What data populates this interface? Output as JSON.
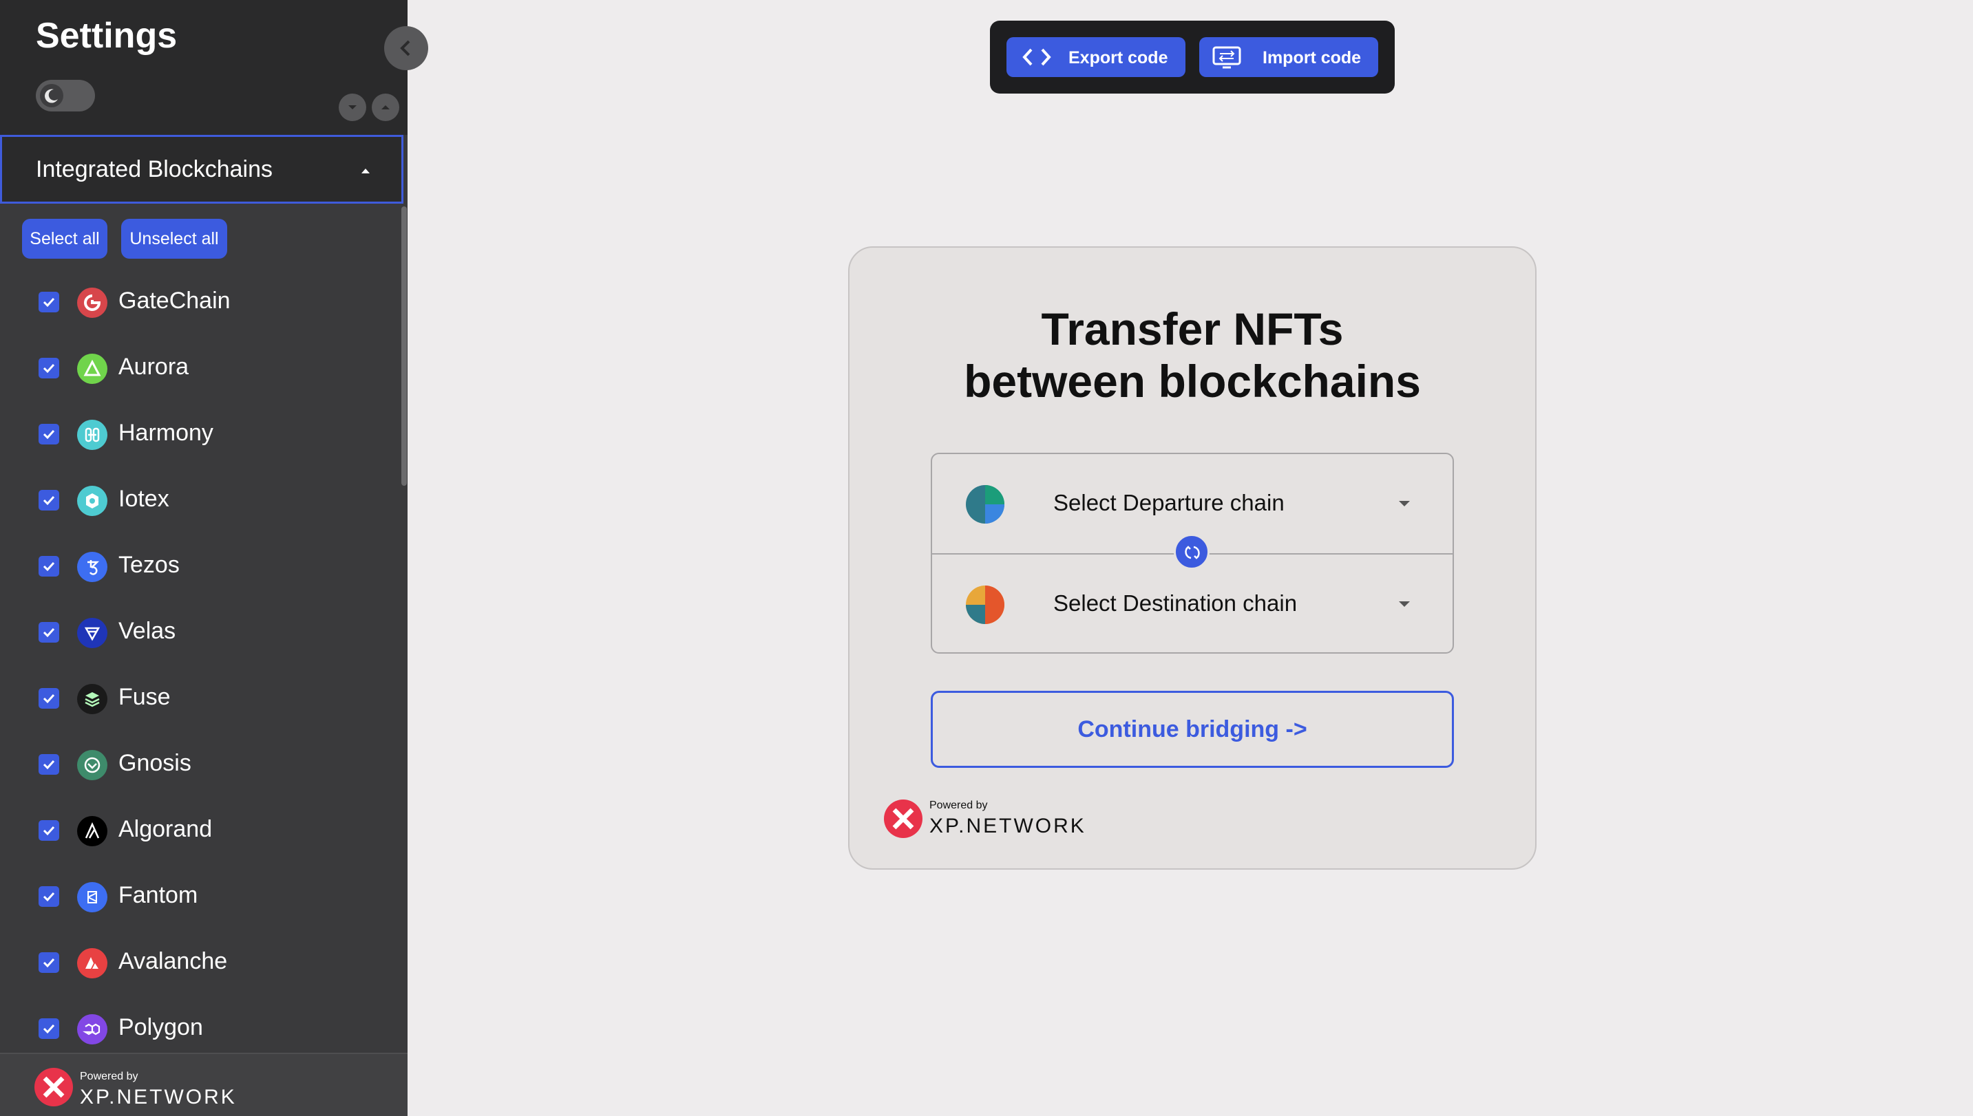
{
  "sidebar": {
    "title": "Settings",
    "section_title": "Integrated Blockchains",
    "select_all": "Select all",
    "unselect_all": "Unselect all",
    "chains": [
      {
        "name": "GateChain",
        "icon": "gatechain-icon",
        "color": "#d7464b",
        "checked": true
      },
      {
        "name": "Aurora",
        "icon": "aurora-icon",
        "color": "#70d44b",
        "checked": true
      },
      {
        "name": "Harmony",
        "icon": "harmony-icon",
        "color": "#4ecbd1",
        "checked": true
      },
      {
        "name": "Iotex",
        "icon": "iotex-icon",
        "color": "#4ecbd1",
        "checked": true
      },
      {
        "name": "Tezos",
        "icon": "tezos-icon",
        "color": "#3d6ef2",
        "checked": true
      },
      {
        "name": "Velas",
        "icon": "velas-icon",
        "color": "#1f35b8",
        "checked": true
      },
      {
        "name": "Fuse",
        "icon": "fuse-icon",
        "color": "#1a1a1a",
        "checked": true
      },
      {
        "name": "Gnosis",
        "icon": "gnosis-icon",
        "color": "#3e8b6b",
        "checked": true
      },
      {
        "name": "Algorand",
        "icon": "algorand-icon",
        "color": "#000000",
        "checked": true
      },
      {
        "name": "Fantom",
        "icon": "fantom-icon",
        "color": "#3d6ef2",
        "checked": true
      },
      {
        "name": "Avalanche",
        "icon": "avalanche-icon",
        "color": "#e84142",
        "checked": true
      },
      {
        "name": "Polygon",
        "icon": "polygon-icon",
        "color": "#8247e5",
        "checked": true
      }
    ],
    "footer": {
      "powered_by": "Powered by",
      "brand": "XP.NETWORK"
    }
  },
  "toolbar": {
    "export_label": "Export code",
    "import_label": "Import code"
  },
  "card": {
    "title_line1": "Transfer NFTs",
    "title_line2": "between blockchains",
    "departure_placeholder": "Select Departure chain",
    "destination_placeholder": "Select Destination chain",
    "continue_label": "Continue bridging ->",
    "powered_by": "Powered by",
    "brand": "XP.NETWORK"
  },
  "colors": {
    "accent": "#3c5bdf",
    "sidebar_bg": "#3a3a3c",
    "page_bg": "#eeeced",
    "brand_red": "#e8334a"
  }
}
